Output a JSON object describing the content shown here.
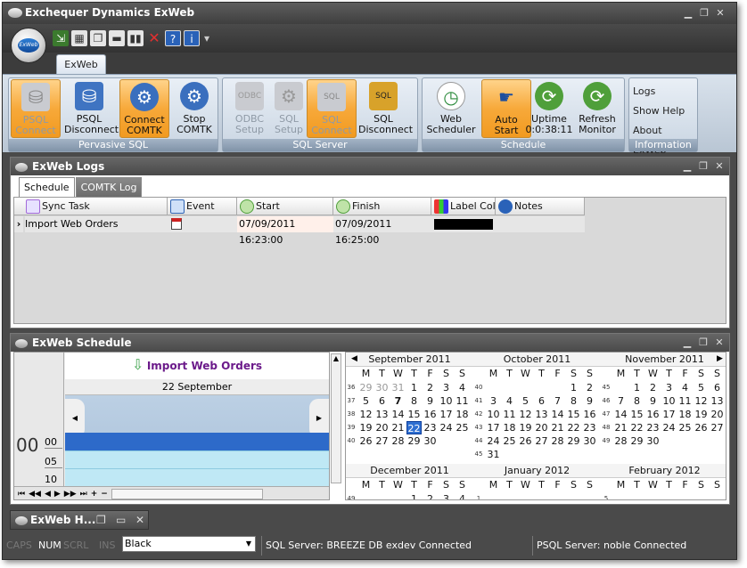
{
  "window": {
    "title": "Exchequer Dynamics ExWeb",
    "minimize": "▁",
    "restore": "❐",
    "close": "✕"
  },
  "app_button": {
    "label": "ExWeb"
  },
  "quick_access": {
    "items": [
      "import-icon",
      "grid-icon",
      "window-icon",
      "bar-icon",
      "columns-icon",
      "delete-icon",
      "help-icon",
      "info-icon"
    ],
    "more": "▾"
  },
  "ribbon_tab": {
    "label": "ExWeb"
  },
  "ribbon": {
    "groups": [
      {
        "title": "Pervasive SQL"
      },
      {
        "title": "SQL Server"
      },
      {
        "title": "Schedule"
      },
      {
        "title": "Information"
      }
    ],
    "buttons": {
      "psql_connect": {
        "l1": "PSQL",
        "l2": "Connect"
      },
      "psql_disconnect": {
        "l1": "PSQL",
        "l2": "Disconnect"
      },
      "connect_comtk": {
        "l1": "Connect",
        "l2": "COMTK"
      },
      "stop_comtk": {
        "l1": "Stop",
        "l2": "COMTK"
      },
      "odbc_setup": {
        "l1": "ODBC",
        "l2": "Setup"
      },
      "sql_setup": {
        "l1": "SQL",
        "l2": "Setup"
      },
      "sql_connect": {
        "l1": "SQL",
        "l2": "Connect"
      },
      "sql_disconnect": {
        "l1": "SQL",
        "l2": "Disconnect"
      },
      "web_scheduler": {
        "l1": "Web",
        "l2": "Scheduler"
      },
      "auto_start": {
        "l1": "Auto",
        "l2": "Start"
      },
      "uptime": {
        "l1": "Uptime",
        "l2": "0:0:38:11"
      },
      "refresh_monitor": {
        "l1": "Refresh",
        "l2": "Monitor"
      }
    },
    "info_links": [
      "Logs",
      "Show Help",
      "About ExWeb"
    ]
  },
  "logs_pane": {
    "title": "ExWeb Logs",
    "tabs": [
      "Schedule",
      "COMTK Log"
    ],
    "columns": [
      "Sync Task",
      "Event Type",
      "Start",
      "Finish",
      "Label Colo",
      "Notes"
    ],
    "row": {
      "task": "Import Web Orders",
      "start": "07/09/2011 16:23:00",
      "finish": "07/09/2011 16:25:00",
      "row_marker": "›"
    }
  },
  "schedule_pane": {
    "title": "ExWeb Schedule",
    "appointment": "Import Web Orders",
    "date_header": "22 September",
    "hour": "00",
    "minutes": [
      "00",
      "05",
      "10"
    ],
    "nav_glyphs": [
      "⏮",
      "◀◀",
      "◀",
      "▶",
      "▶▶",
      "⏭",
      "+",
      "−"
    ]
  },
  "calendar": {
    "months_row1": [
      "September 2011",
      "October 2011",
      "November 2011"
    ],
    "months_row2": [
      "December 2011",
      "January 2012",
      "February 2012"
    ],
    "dow": [
      "M",
      "T",
      "W",
      "T",
      "F",
      "S",
      "S"
    ],
    "sep": {
      "weeks": [
        "36",
        "37",
        "38",
        "39",
        "40"
      ],
      "days": [
        [
          "29",
          "30",
          "31",
          "1",
          "2",
          "3",
          "4"
        ],
        [
          "5",
          "6",
          "7",
          "8",
          "9",
          "10",
          "11"
        ],
        [
          "12",
          "13",
          "14",
          "15",
          "16",
          "17",
          "18"
        ],
        [
          "19",
          "20",
          "21",
          "22",
          "23",
          "24",
          "25"
        ],
        [
          "26",
          "27",
          "28",
          "29",
          "30",
          "",
          ""
        ]
      ]
    },
    "oct": {
      "weeks": [
        "40",
        "41",
        "42",
        "43",
        "44",
        "45"
      ],
      "days": [
        [
          "",
          "",
          "",
          "",
          "",
          "1",
          "2"
        ],
        [
          "3",
          "4",
          "5",
          "6",
          "7",
          "8",
          "9"
        ],
        [
          "10",
          "11",
          "12",
          "13",
          "14",
          "15",
          "16"
        ],
        [
          "17",
          "18",
          "19",
          "20",
          "21",
          "22",
          "23"
        ],
        [
          "24",
          "25",
          "26",
          "27",
          "28",
          "29",
          "30"
        ],
        [
          "31",
          "",
          "",
          "",
          "",
          "",
          ""
        ]
      ]
    },
    "nov": {
      "weeks": [
        "45",
        "46",
        "47",
        "48",
        "49"
      ],
      "days": [
        [
          "",
          "1",
          "2",
          "3",
          "4",
          "5",
          "6"
        ],
        [
          "7",
          "8",
          "9",
          "10",
          "11",
          "12",
          "13"
        ],
        [
          "14",
          "15",
          "16",
          "17",
          "18",
          "19",
          "20"
        ],
        [
          "21",
          "22",
          "23",
          "24",
          "25",
          "26",
          "27"
        ],
        [
          "28",
          "29",
          "30",
          "",
          "",
          "",
          ""
        ]
      ]
    },
    "row2_partial": {
      "weeks": [
        "49",
        "1",
        "5"
      ],
      "days": [
        "1",
        "2",
        "3",
        "4"
      ]
    },
    "prev": "◀",
    "next": "▶"
  },
  "minimized_pane": {
    "title": "ExWeb H..."
  },
  "statusbar": {
    "caps": "CAPS",
    "num": "NUM",
    "scrl": "SCRL",
    "ins": "INS",
    "color_select": "Black",
    "sql_status": "SQL Server: BREEZE DB exdev Connected",
    "psql_status": "PSQL Server: noble Connected"
  },
  "colors": {
    "active_orange": "#f7a93a",
    "schedule_blue": "#2f6fd1",
    "label_black": "#000000"
  }
}
